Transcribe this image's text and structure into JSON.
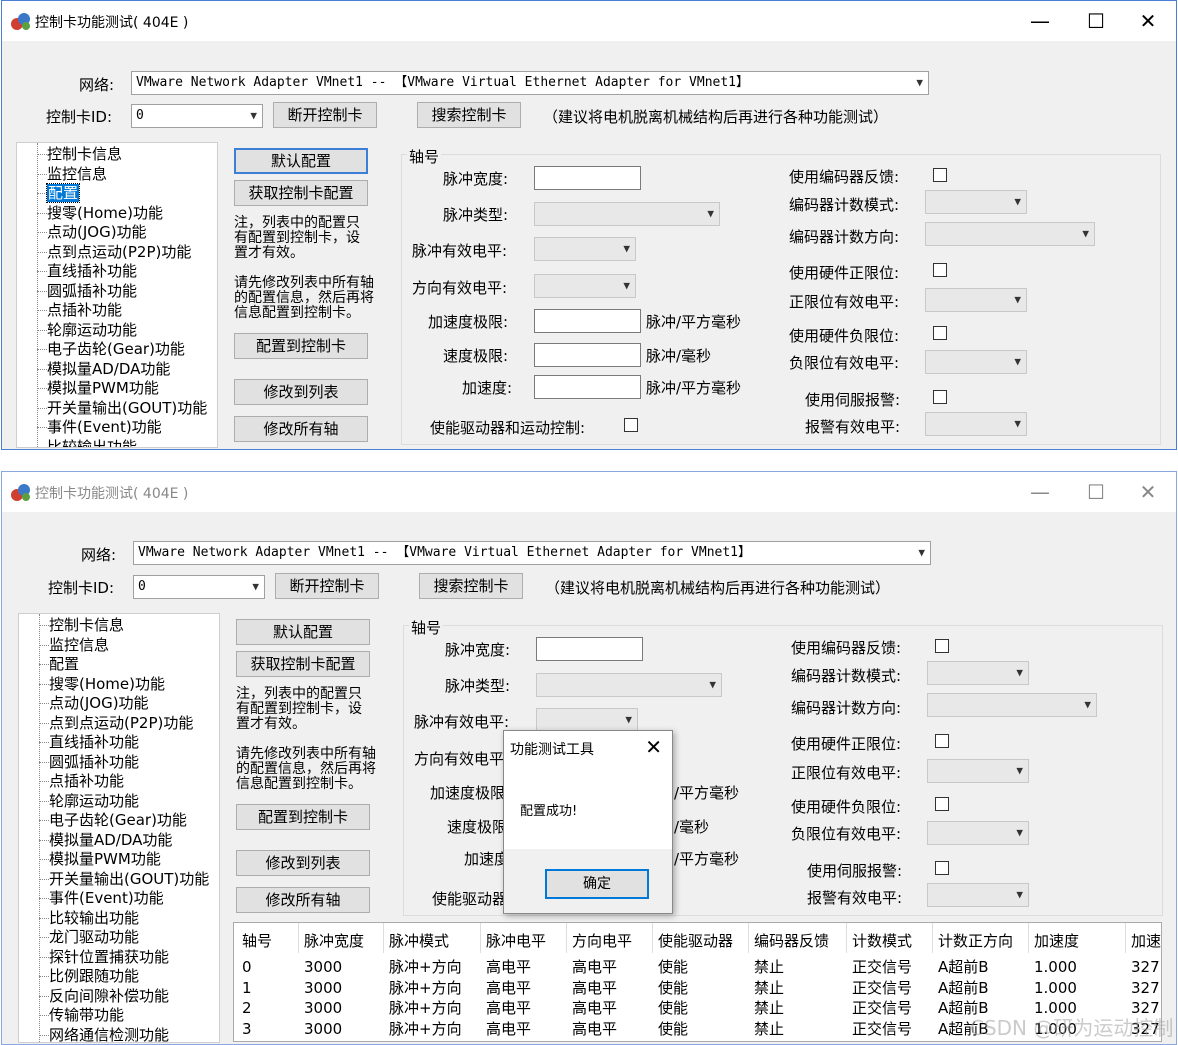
{
  "window": {
    "title": "控制卡功能测试( 404E )",
    "caption_min": "—",
    "caption_max": "☐",
    "caption_close": "✕"
  },
  "header": {
    "network_label": "网络:",
    "network_value": "VMware Network Adapter VMnet1 -- 【VMware Virtual Ethernet Adapter for VMnet1】",
    "card_id_label": "控制卡ID:",
    "card_id_value": "0",
    "disconnect_button": "断开控制卡",
    "search_button": "搜索控制卡",
    "hint": "（建议将电机脱离机械结构后再进行各种功能测试）"
  },
  "tree": {
    "items": [
      "控制卡信息",
      "监控信息",
      "配置",
      "搜零(Home)功能",
      "点动(JOG)功能",
      "点到点运动(P2P)功能",
      "直线插补功能",
      "圆弧插补功能",
      "点插补功能",
      "轮廓运动功能",
      "电子齿轮(Gear)功能",
      "模拟量AD/DA功能",
      "模拟量PWM功能",
      "开关量输出(GOUT)功能",
      "事件(Event)功能",
      "比较输出功能",
      "龙门驱动功能",
      "探针位置捕获功能",
      "比例跟随功能",
      "反向间隙补偿功能",
      "传输带功能",
      "网络通信检测功能"
    ],
    "selected_index": 2
  },
  "buttons": {
    "default_config": "默认配置",
    "get_config": "获取控制卡配置",
    "config_to_card": "配置到控制卡",
    "modify_to_list": "修改到列表",
    "modify_all_axes": "修改所有轴"
  },
  "notes": {
    "note1": "注，列表中的配置只\n有配置到控制卡，设\n置才有效。",
    "note2": "请先修改列表中所有轴\n的配置信息，然后再将\n信息配置到控制卡。"
  },
  "form": {
    "axis_group": "轴号",
    "pulse_width": "脉冲宽度:",
    "pulse_type": "脉冲类型:",
    "pulse_level": "脉冲有效电平:",
    "dir_level": "方向有效电平:",
    "acc_limit": "加速度极限:",
    "acc_unit": "脉冲/平方毫秒",
    "vel_limit": "速度极限:",
    "vel_unit": "脉冲/毫秒",
    "acc": "加速度:",
    "enable_drive": "使能驱动器和运动控制:",
    "use_encoder": "使用编码器反馈:",
    "encoder_mode": "编码器计数模式:",
    "encoder_dir": "编码器计数方向:",
    "use_pos_limit": "使用硬件正限位:",
    "pos_limit_level": "正限位有效电平:",
    "use_neg_limit": "使用硬件负限位:",
    "neg_limit_level": "负限位有效电平:",
    "use_alarm": "使用伺服报警:",
    "alarm_level": "报警有效电平:",
    "w2_acc_limit_clip": "加速度极限",
    "w2_vel_limit_clip": "速度极限",
    "w2_acc_clip": "加速度",
    "w2_dir_clip": "方向有效电平",
    "w2_enable_clip": "使能驱动器",
    "w2_acc_unit_clip": "/平方毫秒",
    "w2_vel_unit_clip": "/毫秒"
  },
  "dialog": {
    "title": "功能测试工具",
    "message": "配置成功!",
    "ok": "确定",
    "close": "✕"
  },
  "table": {
    "headers": [
      "轴号",
      "脉冲宽度",
      "脉冲模式",
      "脉冲电平",
      "方向电平",
      "使能驱动器",
      "编码器反馈",
      "计数模式",
      "计数正方向",
      "加速度",
      "加速"
    ],
    "rows": [
      [
        "0",
        "3000",
        "脉冲+方向",
        "高电平",
        "高电平",
        "使能",
        "禁止",
        "正交信号",
        "A超前B",
        "1.000",
        "327"
      ],
      [
        "1",
        "3000",
        "脉冲+方向",
        "高电平",
        "高电平",
        "使能",
        "禁止",
        "正交信号",
        "A超前B",
        "1.000",
        "327"
      ],
      [
        "2",
        "3000",
        "脉冲+方向",
        "高电平",
        "高电平",
        "使能",
        "禁止",
        "正交信号",
        "A超前B",
        "1.000",
        "327"
      ],
      [
        "3",
        "3000",
        "脉冲+方向",
        "高电平",
        "高电平",
        "使能",
        "禁止",
        "正交信号",
        "A超前B",
        "1.000",
        "327"
      ]
    ]
  },
  "watermark": "CSDN @研为运动控制"
}
